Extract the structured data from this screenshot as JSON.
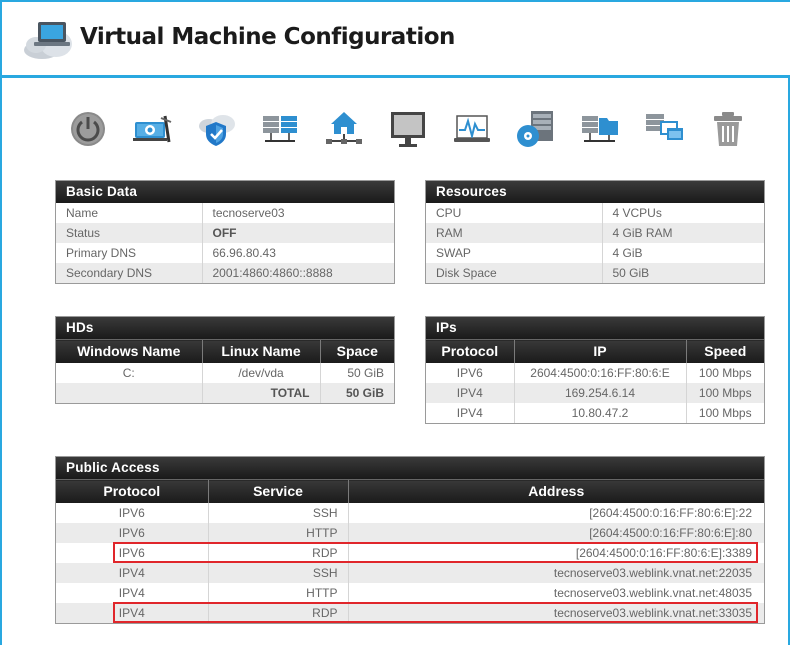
{
  "header": {
    "title": "Virtual Machine Configuration"
  },
  "toolbar": {
    "icons": [
      "power-icon",
      "tools-icon",
      "shield-cloud-icon",
      "server-network-icon",
      "home-network-icon",
      "monitor-icon",
      "activity-icon",
      "server-disc-icon",
      "server-folder-icon",
      "server-windows-icon",
      "trash-icon"
    ]
  },
  "colors": {
    "accent": "#29a8e0",
    "highlight": "#e0262b",
    "header_bar": "#1a1a1a"
  },
  "basic_data": {
    "title": "Basic Data",
    "rows": [
      {
        "k": "Name",
        "v": "tecnoserve03"
      },
      {
        "k": "Status",
        "v": "OFF"
      },
      {
        "k": "Primary DNS",
        "v": "66.96.80.43"
      },
      {
        "k": "Secondary DNS",
        "v": "2001:4860:4860::8888"
      }
    ]
  },
  "resources": {
    "title": "Resources",
    "rows": [
      {
        "k": "CPU",
        "v": "4 VCPUs"
      },
      {
        "k": "RAM",
        "v": "4 GiB RAM"
      },
      {
        "k": "SWAP",
        "v": "4 GiB"
      },
      {
        "k": "Disk Space",
        "v": "50 GiB"
      }
    ]
  },
  "hds": {
    "title": "HDs",
    "columns": [
      "Windows Name",
      "Linux Name",
      "Space"
    ],
    "rows": [
      {
        "win": "C:",
        "linux": "/dev/vda",
        "space": "50 GiB"
      }
    ],
    "total_label": "TOTAL",
    "total_value": "50 GiB"
  },
  "ips": {
    "title": "IPs",
    "columns": [
      "Protocol",
      "IP",
      "Speed"
    ],
    "rows": [
      {
        "proto": "IPV6",
        "ip": "2604:4500:0:16:FF:80:6:E",
        "speed": "100 Mbps"
      },
      {
        "proto": "IPV4",
        "ip": "169.254.6.14",
        "speed": "100 Mbps"
      },
      {
        "proto": "IPV4",
        "ip": "10.80.47.2",
        "speed": "100 Mbps"
      }
    ]
  },
  "public_access": {
    "title": "Public Access",
    "columns": [
      "Protocol",
      "Service",
      "Address"
    ],
    "rows": [
      {
        "proto": "IPV6",
        "service": "SSH",
        "address": "[2604:4500:0:16:FF:80:6:E]:22"
      },
      {
        "proto": "IPV6",
        "service": "HTTP",
        "address": "[2604:4500:0:16:FF:80:6:E]:80"
      },
      {
        "proto": "IPV6",
        "service": "RDP",
        "address": "[2604:4500:0:16:FF:80:6:E]:3389"
      },
      {
        "proto": "IPV4",
        "service": "SSH",
        "address": "tecnoserve03.weblink.vnat.net:22035"
      },
      {
        "proto": "IPV4",
        "service": "HTTP",
        "address": "tecnoserve03.weblink.vnat.net:48035"
      },
      {
        "proto": "IPV4",
        "service": "RDP",
        "address": "tecnoserve03.weblink.vnat.net:33035"
      }
    ]
  }
}
